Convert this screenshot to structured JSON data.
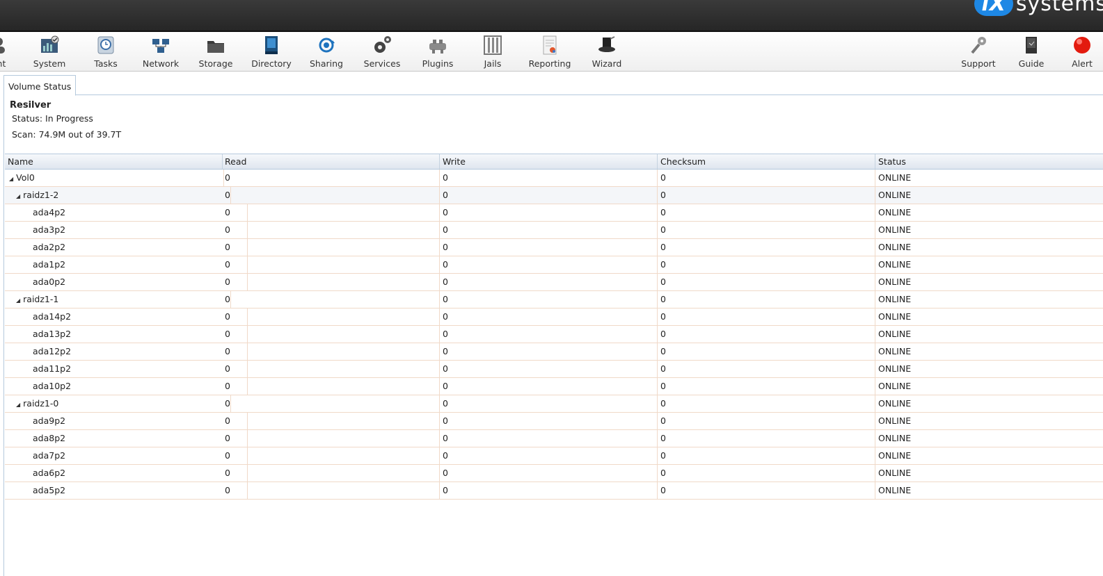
{
  "brand": {
    "logo_text": "systems",
    "logo_prefix": "iX"
  },
  "toolbar": {
    "items": [
      {
        "label": "unt",
        "icon": "account-icon"
      },
      {
        "label": "System",
        "icon": "system-icon"
      },
      {
        "label": "Tasks",
        "icon": "tasks-icon"
      },
      {
        "label": "Network",
        "icon": "network-icon"
      },
      {
        "label": "Storage",
        "icon": "storage-icon"
      },
      {
        "label": "Directory",
        "icon": "directory-icon"
      },
      {
        "label": "Sharing",
        "icon": "sharing-icon"
      },
      {
        "label": "Services",
        "icon": "services-icon"
      },
      {
        "label": "Plugins",
        "icon": "plugins-icon"
      },
      {
        "label": "Jails",
        "icon": "jails-icon"
      },
      {
        "label": "Reporting",
        "icon": "reporting-icon"
      },
      {
        "label": "Wizard",
        "icon": "wizard-icon"
      },
      {
        "label": "Support",
        "icon": "support-icon"
      },
      {
        "label": "Guide",
        "icon": "guide-icon"
      },
      {
        "label": "Alert",
        "icon": "alert-icon"
      }
    ]
  },
  "tab": {
    "label": "Volume Status"
  },
  "resilver": {
    "heading": "Resilver",
    "status": "Status: In Progress",
    "scan": "Scan: 74.9M out of 39.7T"
  },
  "table": {
    "columns": [
      "Name",
      "Read",
      "Write",
      "Checksum",
      "Status"
    ],
    "rows": [
      {
        "name": "Vol0",
        "read": "0",
        "write": "0",
        "checksum": "0",
        "status": "ONLINE"
      },
      {
        "name": "raidz1-2",
        "read": "0",
        "write": "0",
        "checksum": "0",
        "status": "ONLINE"
      },
      {
        "name": "ada4p2",
        "read": "0",
        "write": "0",
        "checksum": "0",
        "status": "ONLINE"
      },
      {
        "name": "ada3p2",
        "read": "0",
        "write": "0",
        "checksum": "0",
        "status": "ONLINE"
      },
      {
        "name": "ada2p2",
        "read": "0",
        "write": "0",
        "checksum": "0",
        "status": "ONLINE"
      },
      {
        "name": "ada1p2",
        "read": "0",
        "write": "0",
        "checksum": "0",
        "status": "ONLINE"
      },
      {
        "name": "ada0p2",
        "read": "0",
        "write": "0",
        "checksum": "0",
        "status": "ONLINE"
      },
      {
        "name": "raidz1-1",
        "read": "0",
        "write": "0",
        "checksum": "0",
        "status": "ONLINE"
      },
      {
        "name": "ada14p2",
        "read": "0",
        "write": "0",
        "checksum": "0",
        "status": "ONLINE"
      },
      {
        "name": "ada13p2",
        "read": "0",
        "write": "0",
        "checksum": "0",
        "status": "ONLINE"
      },
      {
        "name": "ada12p2",
        "read": "0",
        "write": "0",
        "checksum": "0",
        "status": "ONLINE"
      },
      {
        "name": "ada11p2",
        "read": "0",
        "write": "0",
        "checksum": "0",
        "status": "ONLINE"
      },
      {
        "name": "ada10p2",
        "read": "0",
        "write": "0",
        "checksum": "0",
        "status": "ONLINE"
      },
      {
        "name": "raidz1-0",
        "read": "0",
        "write": "0",
        "checksum": "0",
        "status": "ONLINE"
      },
      {
        "name": "ada9p2",
        "read": "0",
        "write": "0",
        "checksum": "0",
        "status": "ONLINE"
      },
      {
        "name": "ada8p2",
        "read": "0",
        "write": "0",
        "checksum": "0",
        "status": "ONLINE"
      },
      {
        "name": "ada7p2",
        "read": "0",
        "write": "0",
        "checksum": "0",
        "status": "ONLINE"
      },
      {
        "name": "ada6p2",
        "read": "0",
        "write": "0",
        "checksum": "0",
        "status": "ONLINE"
      },
      {
        "name": "ada5p2",
        "read": "0",
        "write": "0",
        "checksum": "0",
        "status": "ONLINE"
      }
    ]
  }
}
